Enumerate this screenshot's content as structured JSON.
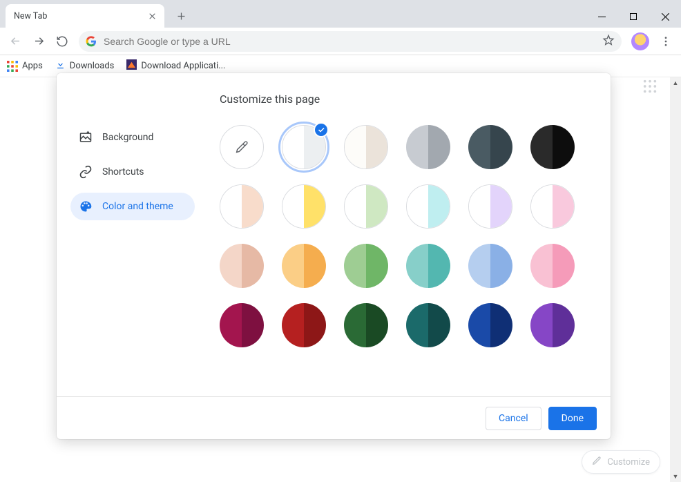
{
  "window": {
    "tab_title": "New Tab"
  },
  "toolbar": {
    "omnibox_placeholder": "Search Google or type a URL"
  },
  "bookmarks": {
    "apps": "Apps",
    "downloads": "Downloads",
    "download_app": "Download Applicati..."
  },
  "dialog": {
    "title": "Customize this page",
    "sidebar": {
      "background": "Background",
      "shortcuts": "Shortcuts",
      "color_theme": "Color and theme"
    },
    "swatches": [
      {
        "type": "picker"
      },
      {
        "left": "#ffffff",
        "right": "#eceff1",
        "bordered": true,
        "selected": true
      },
      {
        "left": "#fdfcf9",
        "right": "#ebe3da",
        "bordered": true
      },
      {
        "left": "#c7cbd1",
        "right": "#a2a8af"
      },
      {
        "left": "#4a5b63",
        "right": "#36454d"
      },
      {
        "left": "#2a2a2a",
        "right": "#0d0d0d"
      },
      {
        "left": "#ffffff",
        "right": "#f8dccb",
        "bordered": true
      },
      {
        "left": "#ffffff",
        "right": "#ffe169",
        "bordered": true
      },
      {
        "left": "#ffffff",
        "right": "#cfe8c2",
        "bordered": true
      },
      {
        "left": "#ffffff",
        "right": "#bfeef0",
        "bordered": true
      },
      {
        "left": "#ffffff",
        "right": "#e3d4fb",
        "bordered": true
      },
      {
        "left": "#ffffff",
        "right": "#f9c9dd",
        "bordered": true
      },
      {
        "left": "#f4d6c8",
        "right": "#e6b9a5"
      },
      {
        "left": "#fbce86",
        "right": "#f5ad4e"
      },
      {
        "left": "#9ecd93",
        "right": "#6fb667"
      },
      {
        "left": "#87cfc9",
        "right": "#53b7b0"
      },
      {
        "left": "#b5ceef",
        "right": "#8ab0e6"
      },
      {
        "left": "#f9c1d3",
        "right": "#f59bb9"
      },
      {
        "left": "#a3154e",
        "right": "#7e1040"
      },
      {
        "left": "#b52020",
        "right": "#8d1717"
      },
      {
        "left": "#2a6a35",
        "right": "#1a4a24"
      },
      {
        "left": "#1b6a6a",
        "right": "#124a4a"
      },
      {
        "left": "#1a4aa8",
        "right": "#0f2f75"
      },
      {
        "left": "#8646c6",
        "right": "#5f2f99"
      }
    ],
    "buttons": {
      "cancel": "Cancel",
      "done": "Done"
    }
  },
  "customize_pill": "Customize"
}
